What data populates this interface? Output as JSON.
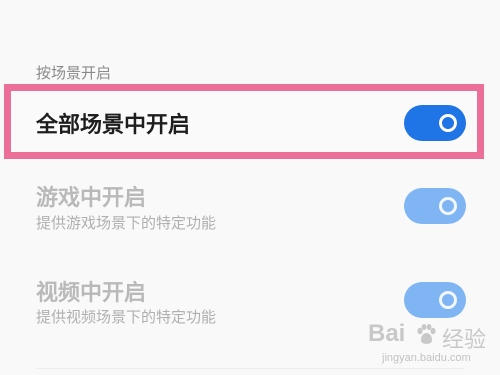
{
  "section": {
    "title": "按场景开启"
  },
  "rows": [
    {
      "title": "全部场景中开启",
      "subtitle": "",
      "enabled": true,
      "toggle_on": true
    },
    {
      "title": "游戏中开启",
      "subtitle": "提供游戏场景下的特定功能",
      "enabled": false,
      "toggle_on": true
    },
    {
      "title": "视频中开启",
      "subtitle": "提供视频场景下的特定功能",
      "enabled": false,
      "toggle_on": true
    }
  ],
  "watermark": {
    "brand": "Bai",
    "brand2": "经验",
    "url": "jingyan.baidu.com"
  },
  "colors": {
    "accent": "#1f74e6",
    "accent_disabled": "#7fb5f3",
    "highlight": "#ec6f9a"
  }
}
